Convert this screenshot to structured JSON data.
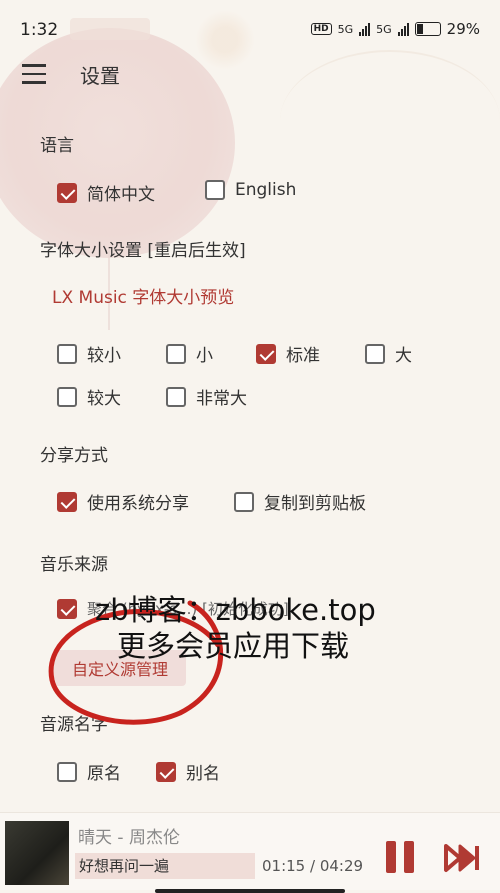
{
  "status_bar": {
    "time": "1:32",
    "hd": "HD",
    "net1": "5G",
    "net2": "5G",
    "battery": "29%"
  },
  "header": {
    "title": "设置"
  },
  "language": {
    "title": "语言",
    "options": [
      {
        "label": "简体中文",
        "checked": true
      },
      {
        "label": "English",
        "checked": false
      }
    ]
  },
  "font_size": {
    "title": "字体大小设置 [重启后生效]",
    "preview": "LX Music 字体大小预览",
    "options": [
      {
        "label": "较小",
        "checked": false
      },
      {
        "label": "小",
        "checked": false
      },
      {
        "label": "标准",
        "checked": true
      },
      {
        "label": "大",
        "checked": false
      },
      {
        "label": "较大",
        "checked": false
      },
      {
        "label": "非常大",
        "checked": false
      }
    ]
  },
  "share": {
    "title": "分享方式",
    "options": [
      {
        "label": "使用系统分享",
        "checked": true
      },
      {
        "label": "复制到剪贴板",
        "checked": false
      }
    ]
  },
  "music_source": {
    "title": "音乐来源",
    "option_label": "聚合  (by   lx-s...)  [初始化成功]",
    "option_checked": true,
    "manage_button": "自定义源管理"
  },
  "source_name": {
    "title": "音源名字",
    "options": [
      {
        "label": "原名",
        "checked": false
      },
      {
        "label": "别名",
        "checked": true
      }
    ]
  },
  "watermark": {
    "line1": "zb博客：zbboke.top",
    "line2": "更多会员应用下载"
  },
  "player": {
    "song": "晴天 - 周杰伦",
    "lyric": "好想再问一遍",
    "time": "01:15 / 04:29"
  },
  "colors": {
    "accent": "#b03a33",
    "background": "#f8f4ee"
  }
}
